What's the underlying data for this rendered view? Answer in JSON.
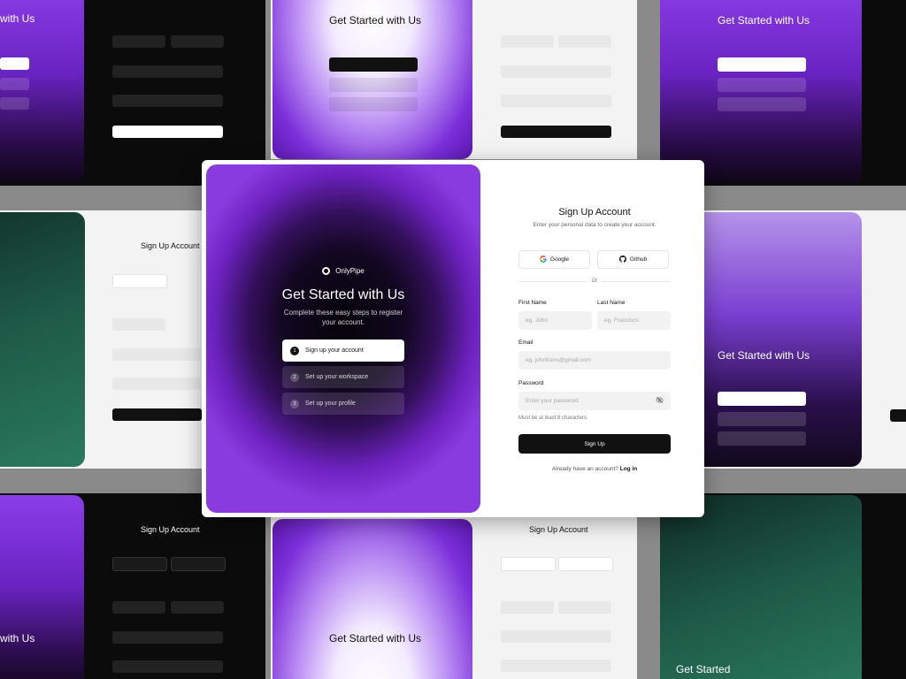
{
  "brand": {
    "name": "OnlyPipe"
  },
  "hero": {
    "title": "Get Started with Us",
    "subtitle": "Complete these easy steps to register your account.",
    "steps": [
      {
        "num": "1",
        "label": "Sign up your account",
        "active": true
      },
      {
        "num": "2",
        "label": "Set up your workspace",
        "active": false
      },
      {
        "num": "3",
        "label": "Set up your profile",
        "active": false
      }
    ]
  },
  "form": {
    "title": "Sign Up Account",
    "subtitle": "Enter your personal data to create your account.",
    "google_label": "Google",
    "github_label": "Github",
    "or_label": "Or",
    "first_name_label": "First Name",
    "first_name_placeholder": "eg. John",
    "last_name_label": "Last Name",
    "last_name_placeholder": "eg. Francisco",
    "email_label": "Email",
    "email_placeholder": "eg. johnfrans@gmail.com",
    "password_label": "Password",
    "password_placeholder": "Enter your password",
    "password_hint": "Must be at least 8 characters.",
    "signup_label": "Sign Up",
    "login_prompt": "Already have an account?",
    "login_link": "Log in"
  },
  "colors": {
    "accent": "#7a2bd1",
    "button": "#111111"
  }
}
